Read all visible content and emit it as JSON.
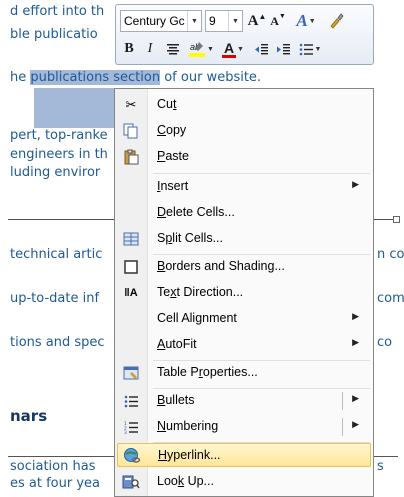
{
  "document": {
    "lines_top": [
      "d effort into th",
      "ble publicatio",
      "he "
    ],
    "selected_text": "publications section",
    "line3_rest": " of our website.",
    "lines_mid": [
      "pert, top-ranke",
      "engineers in th",
      "luding enviror"
    ],
    "lines_lower": [
      "technical artic",
      "up-to-date inf",
      "tions and spec"
    ],
    "right_fragments": [
      "n co",
      "com",
      "co"
    ],
    "heading": "nars",
    "lines_bottom": [
      "sociation has",
      "es at four yea"
    ],
    "bottom_right": "s"
  },
  "mini_toolbar": {
    "font_name": "Century Gc",
    "font_size": "9",
    "grow_font": "A",
    "shrink_font": "A",
    "styles": "A",
    "bold": "B",
    "italic": "I",
    "font_color": "A"
  },
  "menu": {
    "cut": {
      "pre": "Cu",
      "acc": "t",
      "post": ""
    },
    "copy": {
      "pre": "",
      "acc": "C",
      "post": "opy"
    },
    "paste": {
      "pre": "",
      "acc": "P",
      "post": "aste"
    },
    "insert": {
      "pre": "",
      "acc": "I",
      "post": "nsert"
    },
    "delete_cells": {
      "pre": "",
      "acc": "D",
      "post": "elete Cells..."
    },
    "split_cells": {
      "pre": "S",
      "acc": "p",
      "post": "lit Cells..."
    },
    "borders": {
      "pre": "",
      "acc": "B",
      "post": "orders and Shading..."
    },
    "text_direction": {
      "pre": "Te",
      "acc": "x",
      "post": "t Direction..."
    },
    "cell_alignment": {
      "pre": "Cell Alignment",
      "acc": "",
      "post": ""
    },
    "autofit": {
      "pre": "",
      "acc": "A",
      "post": "utoFit"
    },
    "table_properties": {
      "pre": "Table P",
      "acc": "r",
      "post": "operties..."
    },
    "bullets": {
      "pre": "",
      "acc": "B",
      "post": "ullets"
    },
    "numbering": {
      "pre": "",
      "acc": "N",
      "post": "umbering"
    },
    "hyperlink": {
      "pre": "",
      "acc": "H",
      "post": "yperlink..."
    },
    "lookup": {
      "pre": "Loo",
      "acc": "k",
      "post": " Up..."
    }
  },
  "colors": {
    "highlight_fill": "#ffe69a",
    "font_color_bar": "#e00000",
    "highlight_bar": "#ffff00"
  }
}
